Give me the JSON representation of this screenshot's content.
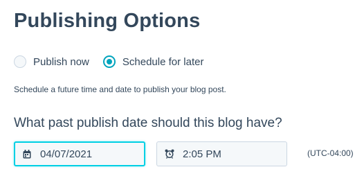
{
  "heading": "Publishing Options",
  "radio": {
    "options": [
      {
        "label": "Publish now",
        "selected": false
      },
      {
        "label": "Schedule for later",
        "selected": true
      }
    ]
  },
  "help_text": "Schedule a future time and date to publish your blog post.",
  "question": "What past publish date should this blog have?",
  "date_field": {
    "value": "04/07/2021",
    "icon": "calendar-icon"
  },
  "time_field": {
    "value": "2:05 PM",
    "icon": "alarm-clock-icon"
  },
  "timezone": "(UTC-04:00)",
  "colors": {
    "accent": "#00a4bd",
    "focus": "#00d0e4",
    "text": "#33475b",
    "border": "#cbd6e2",
    "field_bg": "#f5f8fa"
  }
}
